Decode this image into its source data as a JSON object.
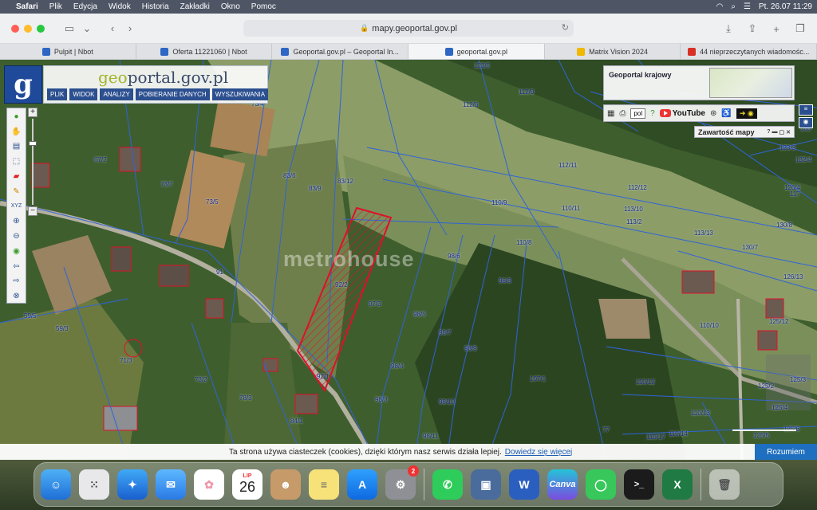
{
  "menubar": {
    "apple": "",
    "app": "Safari",
    "items": [
      "Plik",
      "Edycja",
      "Widok",
      "Historia",
      "Zakładki",
      "Okno",
      "Pomoc"
    ],
    "clock": "Pt. 26.07  11:29"
  },
  "browser": {
    "url": "mapy.geoportal.gov.pl",
    "tabs": [
      {
        "label": "Pulpit | Nbot",
        "color": "#2e66c4"
      },
      {
        "label": "Oferta 11221060 | Nbot",
        "color": "#2e66c4"
      },
      {
        "label": "Geoportal.gov.pl – Geoportal In...",
        "color": "#2e66c4"
      },
      {
        "label": "geoportal.gov.pl",
        "color": "#2e66c4"
      },
      {
        "label": "Matrix Vision 2024",
        "color": "#f0b800"
      },
      {
        "label": "44 nieprzeczytanych wiadomośc...",
        "color": "#d93025"
      }
    ]
  },
  "geoportal": {
    "logo_letter": "g",
    "title_g": "geo",
    "title_rest": "portal.gov.pl",
    "menu": [
      "PLIK",
      "WIDOK",
      "ANALIZY",
      "POBIERANIE DANYCH",
      "WYSZUKIWANIA"
    ],
    "krajowy_label": "Geoportal krajowy",
    "lang": "pol",
    "youtube": "YouTube",
    "zawartosc": "Zawartość mapy",
    "watermark": "metrohouse"
  },
  "parcels": [
    {
      "t": "123/5"
    },
    {
      "t": "112/9"
    },
    {
      "t": "112/6"
    },
    {
      "t": "73/4"
    },
    {
      "t": "73/7"
    },
    {
      "t": "73/5"
    },
    {
      "t": "67/2"
    },
    {
      "t": "83/6"
    },
    {
      "t": "83/9"
    },
    {
      "t": "83/12"
    },
    {
      "t": "110/9"
    },
    {
      "t": "110/11"
    },
    {
      "t": "112/11"
    },
    {
      "t": "112/12"
    },
    {
      "t": "113/10"
    },
    {
      "t": "113/2"
    },
    {
      "t": "113/13"
    },
    {
      "t": "110/8"
    },
    {
      "t": "92/2"
    },
    {
      "t": "97/3"
    },
    {
      "t": "96/8"
    },
    {
      "t": "98/5"
    },
    {
      "t": "98/7"
    },
    {
      "t": "98/9"
    },
    {
      "t": "98/4"
    },
    {
      "t": "98/3"
    },
    {
      "t": "98/10"
    },
    {
      "t": "92/1"
    },
    {
      "t": "91"
    },
    {
      "t": "59/5"
    },
    {
      "t": "59/3"
    },
    {
      "t": "71/3"
    },
    {
      "t": "73/2"
    },
    {
      "t": "78/3"
    },
    {
      "t": "84/1"
    },
    {
      "t": "107/1"
    },
    {
      "t": "110/12"
    },
    {
      "t": "110/10"
    },
    {
      "t": "125/12"
    },
    {
      "t": "125/3"
    },
    {
      "t": "125/2"
    },
    {
      "t": "125/4"
    },
    {
      "t": "125/5"
    },
    {
      "t": "125/6"
    },
    {
      "t": "130/7"
    },
    {
      "t": "130/8"
    },
    {
      "t": "132/4"
    },
    {
      "t": "123/3"
    },
    {
      "t": "126/13"
    },
    {
      "t": "126/4"
    },
    {
      "t": "117"
    },
    {
      "t": "110/13"
    },
    {
      "t": "110/14"
    },
    {
      "t": "110/17"
    },
    {
      "t": "98/11"
    },
    {
      "t": "98/6"
    },
    {
      "t": "133"
    },
    {
      "t": "77"
    }
  ],
  "cookie": {
    "text": "Ta strona używa ciasteczek (cookies), dzięki którym nasz serwis działa lepiej.",
    "link": "Dowiedz się więcej",
    "button": "Rozumiem"
  },
  "dock": {
    "calendar_month": "LIP",
    "calendar_day": "26",
    "settings_badge": "2",
    "apps": [
      "Finder",
      "Launchpad",
      "Safari",
      "Mail",
      "Photos",
      "Calendar",
      "Contacts",
      "Notes",
      "App Store",
      "System Settings",
      "WhatsApp",
      "Preview",
      "Word",
      "Canva",
      "Messages",
      "Terminal",
      "Excel",
      "Trash"
    ]
  }
}
